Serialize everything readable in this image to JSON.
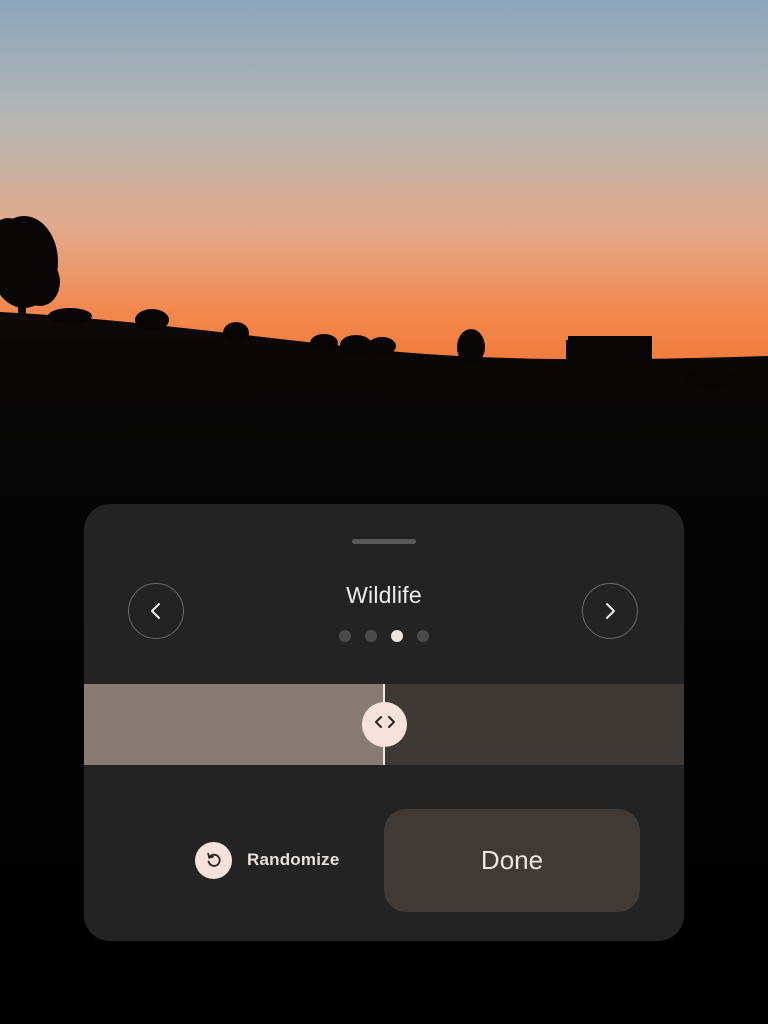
{
  "wallpaper": {
    "description_icon": "sunset-sheep-silhouette-photo",
    "colors": {
      "sky_top": "#8fa9bf",
      "sky_mid": "#d9b7a2",
      "horizon": "#f08a4b",
      "ground": "#050505"
    }
  },
  "sheet": {
    "background": "#232323",
    "title": "Wildlife",
    "prev_icon": "chevron-left-icon",
    "next_icon": "chevron-right-icon",
    "page_dots": {
      "count": 4,
      "active_index": 2
    },
    "slider": {
      "value_fraction": 0.5,
      "handle_icon": "left-right-arrows-icon",
      "left_color": "#887b74",
      "right_color": "#3e3935"
    },
    "randomize": {
      "label": "Randomize",
      "icon": "refresh-icon"
    },
    "done": {
      "label": "Done"
    }
  }
}
